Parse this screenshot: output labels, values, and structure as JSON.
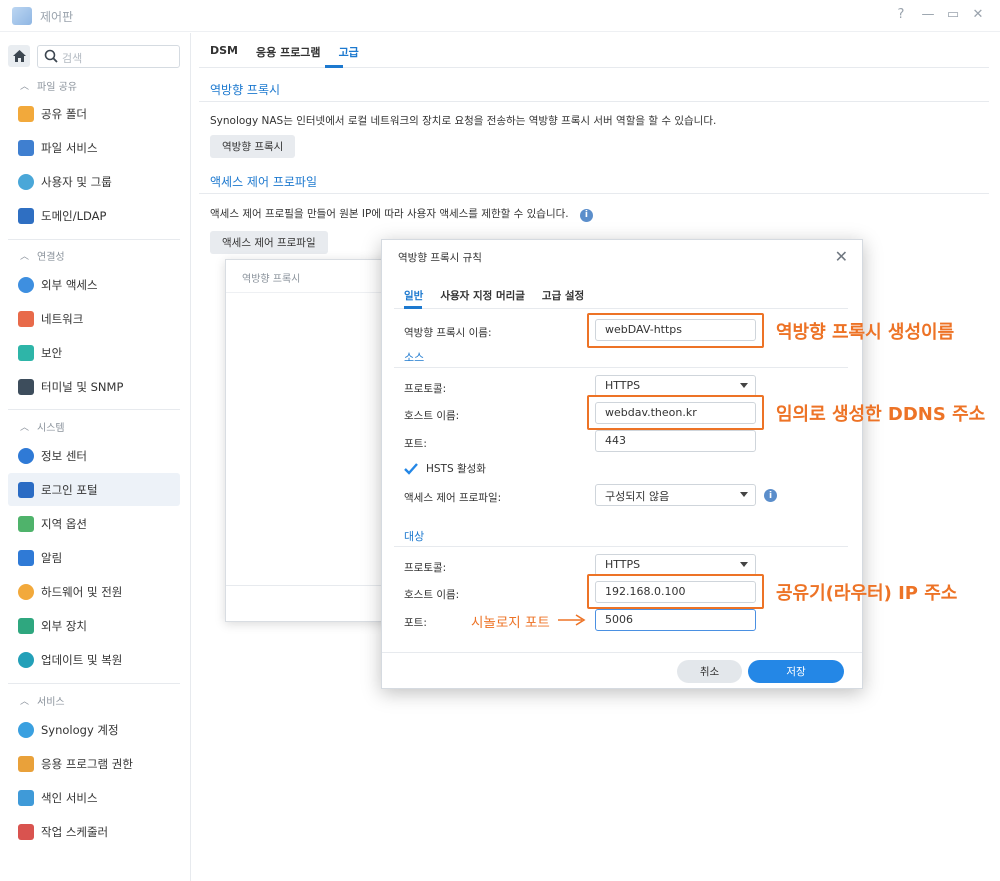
{
  "window": {
    "title": "제어판",
    "help": "?",
    "minimize": "—",
    "maximize": "▭",
    "close": "✕"
  },
  "sidebar": {
    "search_placeholder": "검색",
    "sections": [
      {
        "title": "파일 공유",
        "items": [
          "공유 폴더",
          "파일 서비스",
          "사용자 및 그룹",
          "도메인/LDAP"
        ]
      },
      {
        "title": "연결성",
        "items": [
          "외부 액세스",
          "네트워크",
          "보안",
          "터미널 및 SNMP"
        ]
      },
      {
        "title": "시스템",
        "items": [
          "정보 센터",
          "로그인 포털",
          "지역 옵션",
          "알림",
          "하드웨어 및 전원",
          "외부 장치",
          "업데이트 및 복원"
        ]
      },
      {
        "title": "서비스",
        "items": [
          "Synology 계정",
          "응용 프로그램 권한",
          "색인 서비스",
          "작업 스케줄러"
        ]
      }
    ],
    "active_item": "로그인 포털"
  },
  "main": {
    "tabs": [
      "DSM",
      "응용 프로그램",
      "고급"
    ],
    "active_tab": "고급",
    "reverse_proxy": {
      "heading": "역방향 프록시",
      "description": "Synology NAS는 인터넷에서 로컬 네트워크의 장치로 요청을 전송하는 역방향 프록시 서버 역할을 할 수 있습니다.",
      "button": "역방향 프록시"
    },
    "access_profile": {
      "heading": "액세스 제어 프로파일",
      "description": "액세스 제어 프로필을 만들어 원본 IP에 따라 사용자 액세스를 제한할 수 있습니다.",
      "button": "액세스 제어 프로파일"
    }
  },
  "back_window": {
    "title": "역방향 프록시"
  },
  "dialog": {
    "title": "역방향 프록시 규칙",
    "tabs": [
      "일반",
      "사용자 지정 머리글",
      "고급 설정"
    ],
    "active_tab": "일반",
    "name_label": "역방향 프록시 이름:",
    "name_value": "webDAV-https",
    "source_heading": "소스",
    "source": {
      "protocol_label": "프로토콜:",
      "protocol_value": "HTTPS",
      "host_label": "호스트 이름:",
      "host_value": "webdav.theon.kr",
      "port_label": "포트:",
      "port_value": "443",
      "hsts_label": "HSTS 활성화",
      "hsts_checked": true,
      "acl_label": "액세스 제어 프로파일:",
      "acl_value": "구성되지 않음"
    },
    "dest_heading": "대상",
    "dest": {
      "protocol_label": "프로토콜:",
      "protocol_value": "HTTPS",
      "host_label": "호스트 이름:",
      "host_value": "192.168.0.100",
      "port_label": "포트:",
      "port_value": "5006"
    },
    "cancel": "취소",
    "save": "저장"
  },
  "annotations": {
    "name": "역방향 프록시 생성이름",
    "ddns": "임의로 생성한 DDNS 주소",
    "router_ip": "공유기(라우터) IP 주소",
    "synology_port": "시놀로지 포트",
    "color": "#ed7326"
  }
}
